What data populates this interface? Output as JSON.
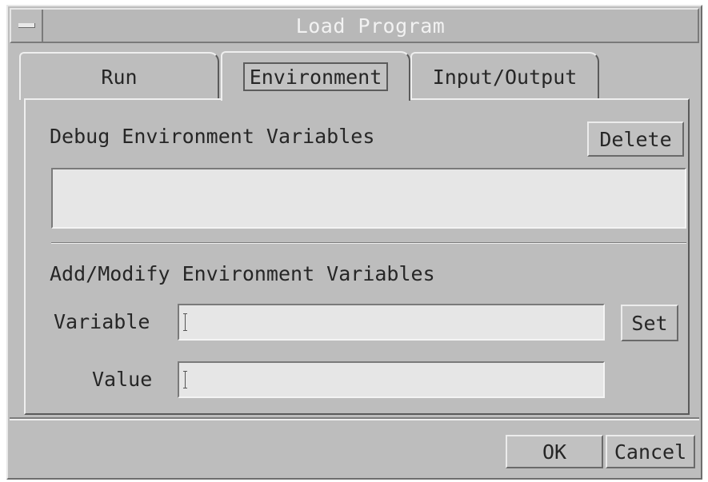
{
  "window": {
    "title": "Load Program"
  },
  "tabs": [
    {
      "label": "Run",
      "active": false
    },
    {
      "label": "Environment",
      "active": true
    },
    {
      "label": "Input/Output",
      "active": false
    }
  ],
  "debug_section": {
    "heading": "Debug Environment Variables",
    "delete_label": "Delete",
    "variables": []
  },
  "modify_section": {
    "heading": "Add/Modify Environment Variables",
    "variable_label": "Variable",
    "variable_value": "",
    "value_label": "Value",
    "value_value": "",
    "set_label": "Set"
  },
  "footer": {
    "ok_label": "OK",
    "cancel_label": "Cancel"
  },
  "icons": {
    "window_menu": "window-menu-icon",
    "text_cursor": "text-cursor-icon"
  },
  "colors": {
    "background": "#bdbdbd",
    "title_text": "#f2f2f2",
    "field_bg": "#e6e6e6"
  }
}
